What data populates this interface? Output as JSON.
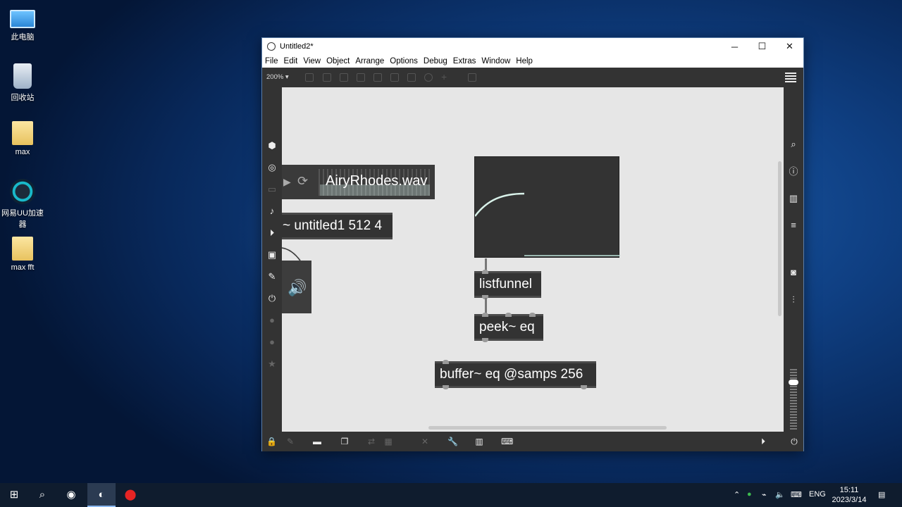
{
  "desktop": {
    "icons": [
      {
        "label": "此电脑",
        "icon": "computer-icon"
      },
      {
        "label": "回收站",
        "icon": "recycle-bin-icon"
      },
      {
        "label": "max",
        "icon": "folder-icon"
      },
      {
        "label": "网易UU加速器",
        "icon": "uu-accelerator-icon"
      },
      {
        "label": "max fft",
        "icon": "folder-icon"
      }
    ]
  },
  "window": {
    "title": "Untitled2*",
    "controls": {
      "minimize": "─",
      "maximize": "☐",
      "close": "✕"
    },
    "menu": [
      "File",
      "Edit",
      "View",
      "Object",
      "Arrange",
      "Options",
      "Debug",
      "Extras",
      "Window",
      "Help"
    ],
    "zoom": "200% ▾"
  },
  "patch": {
    "playlist_file": "AiryRhodes.wav",
    "objects": {
      "sfplay": "~ untitled1 512 4",
      "listfunnel": "listfunnel",
      "peek": "peek~ eq",
      "buffer": "buffer~ eq @samps 256"
    }
  },
  "taskbar": {
    "tray_lang": "ENG",
    "time": "15:11",
    "date": "2023/3/14"
  },
  "colors": {
    "canvas": "#e6e6e6",
    "object_bg": "#333333",
    "accent": "#0078d7"
  }
}
